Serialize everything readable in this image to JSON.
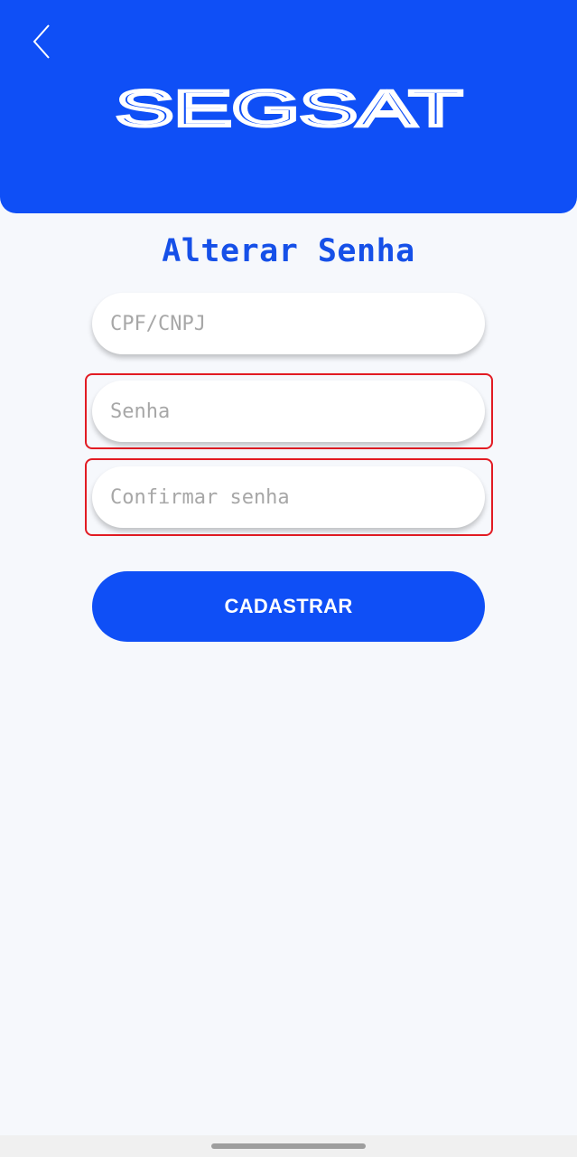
{
  "header": {
    "brand": "SEGSAT",
    "back_icon": "chevron-left-icon",
    "color": "#0f4ff6"
  },
  "page": {
    "title": "Alterar Senha"
  },
  "form": {
    "cpf_cnpj": {
      "placeholder": "CPF/CNPJ",
      "value": "",
      "error": false
    },
    "senha": {
      "placeholder": "Senha",
      "value": "",
      "error": true
    },
    "confirmar_senha": {
      "placeholder": "Confirmar senha",
      "value": "",
      "error": true
    },
    "submit_label": "CADASTRAR",
    "error_color": "#e21b23"
  }
}
